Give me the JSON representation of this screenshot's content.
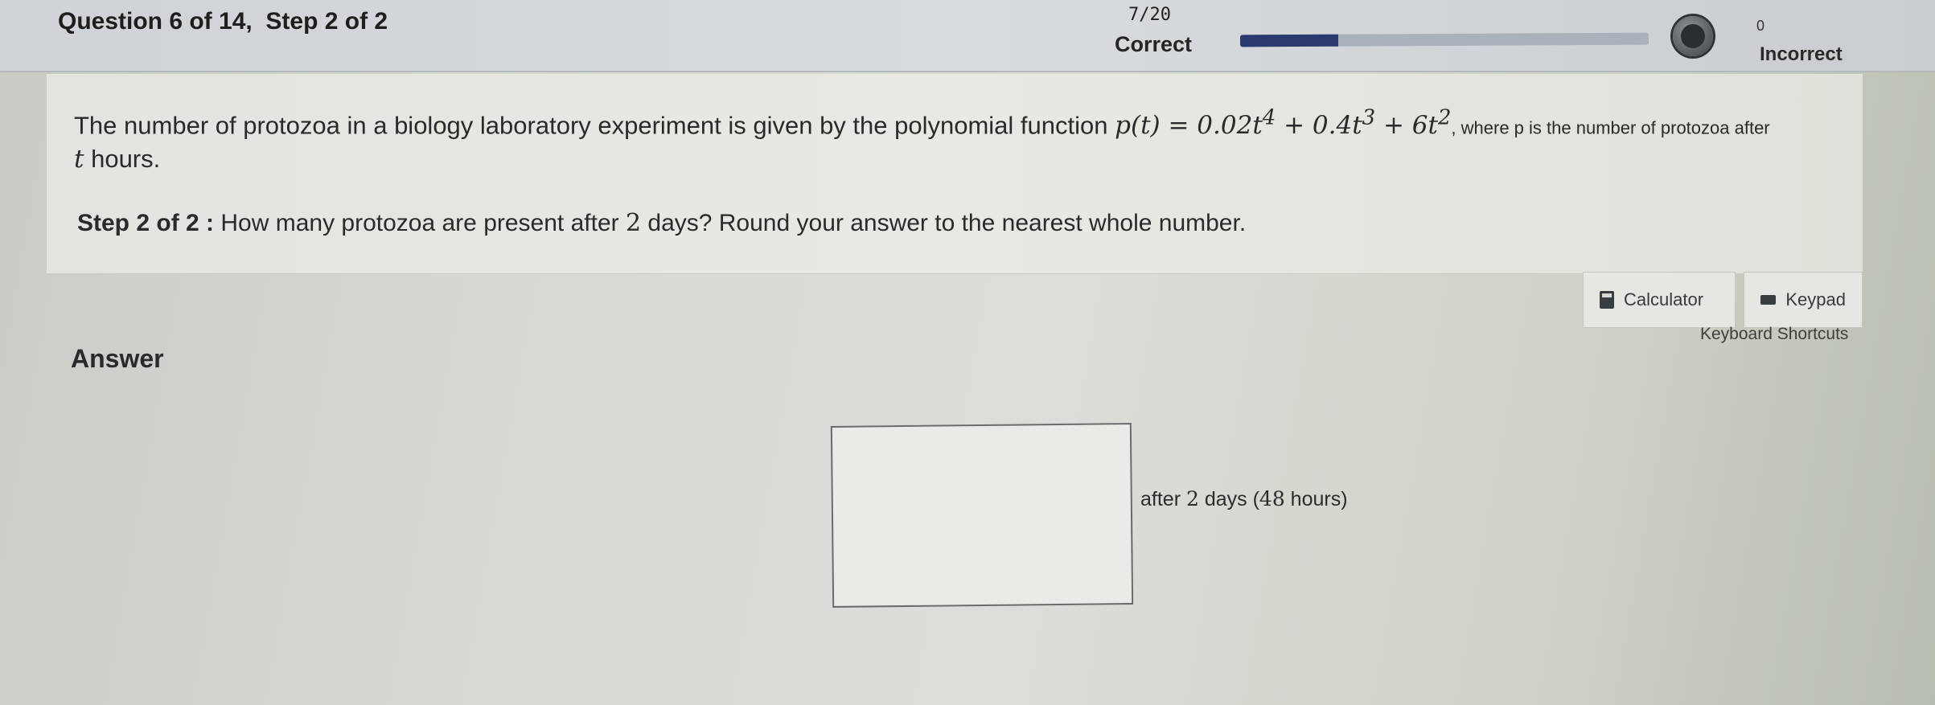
{
  "header": {
    "question_title": "Question 6 of 14,  Step 2 of 2",
    "score_fraction": "7/20",
    "correct_label": "Correct",
    "progress": 0.24,
    "incorrect_count": "0",
    "incorrect_label": "Incorrect"
  },
  "question": {
    "intro": "The number of protozoa in a biology laboratory experiment is given by the polynomial function ",
    "function_lhs": "p(t) = 0.02t",
    "exp4": "4",
    "term2": " + 0.4t",
    "exp3": "3",
    "term3": " + 6t",
    "exp2": "2",
    "tail": ", where p is the number of protozoa after",
    "line2_var": "t",
    "line2_rest": " hours.",
    "step_label": "Step 2 of 2 :",
    "step_pre": "  How many protozoa are present after ",
    "step_num": "2",
    "step_post": " days? Round your answer to the nearest whole number."
  },
  "tools": {
    "calculator_label": "Calculator",
    "keypad_label": "Keypad",
    "shortcuts_label": "Keyboard Shortcuts"
  },
  "answer": {
    "label": "Answer",
    "input_value": "",
    "suffix_pre": "after ",
    "suffix_num": "2",
    "suffix_mid": " days (",
    "suffix_hours": "48",
    "suffix_post": " hours)"
  },
  "icons": {
    "medal": "medal-icon",
    "calculator": "calculator-icon",
    "keypad": "keypad-icon"
  },
  "colors": {
    "progress_fill": "#2a3a6e",
    "progress_track": "#a9b1ba"
  }
}
